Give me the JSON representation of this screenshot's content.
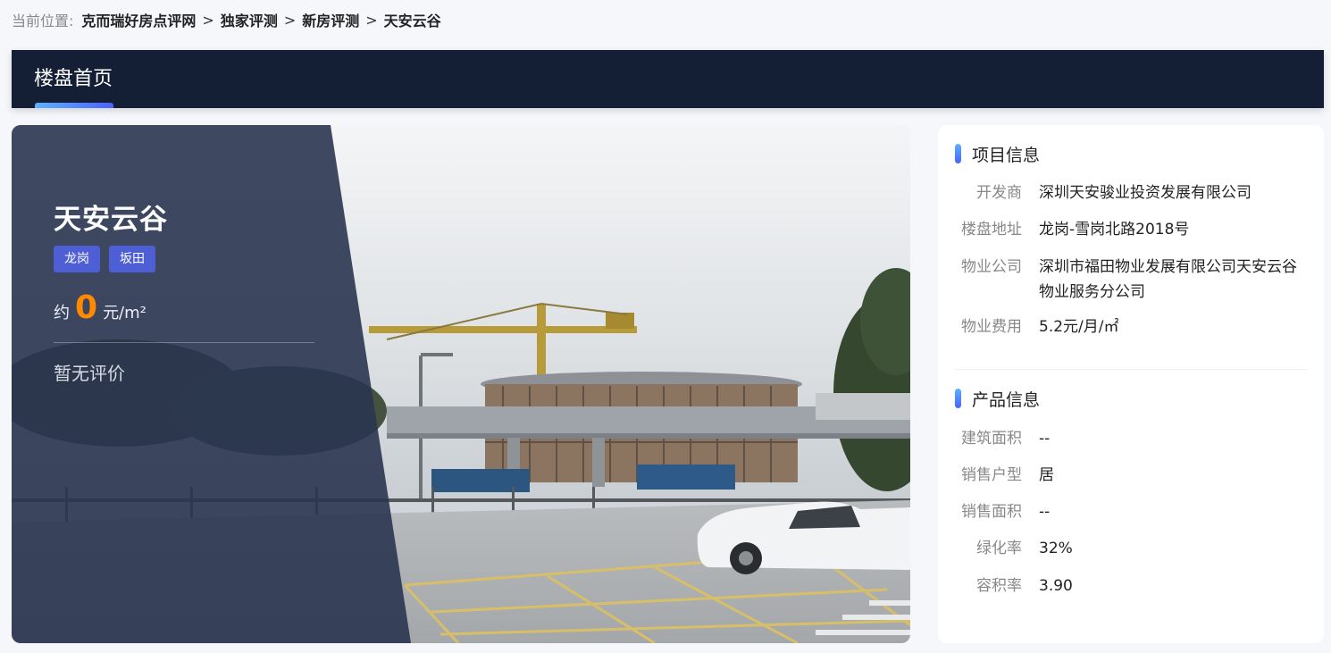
{
  "breadcrumb": {
    "lead": "当前位置:",
    "items": [
      "克而瑞好房点评网",
      "独家评测",
      "新房评测",
      "天安云谷"
    ],
    "separator": ">"
  },
  "nav": {
    "tabs": [
      {
        "label": "楼盘首页",
        "active": true
      }
    ]
  },
  "hero": {
    "title": "天安云谷",
    "tags": [
      "龙岗",
      "坂田"
    ],
    "price_prefix": "约",
    "price_value": "0",
    "price_unit": "元/m²",
    "review": "暂无评价"
  },
  "project_info": {
    "heading": "项目信息",
    "rows": [
      {
        "label": "开发商",
        "value": "深圳天安骏业投资发展有限公司"
      },
      {
        "label": "楼盘地址",
        "value": "龙岗-雪岗北路2018号"
      },
      {
        "label": "物业公司",
        "value": "深圳市福田物业发展有限公司天安云谷物业服务分公司"
      },
      {
        "label": "物业费用",
        "value": "5.2元/月/㎡"
      }
    ]
  },
  "product_info": {
    "heading": "产品信息",
    "rows": [
      {
        "label": "建筑面积",
        "value": "--"
      },
      {
        "label": "销售户型",
        "value": "居"
      },
      {
        "label": "销售面积",
        "value": "--"
      },
      {
        "label": "绿化率",
        "value": "32%"
      },
      {
        "label": "容积率",
        "value": "3.90"
      }
    ]
  },
  "colors": {
    "navbar_bg": "#141f36",
    "accent_orange": "#ff8a00",
    "tag_bg": "#4e5fd6",
    "accent_blue": "#4a62ff"
  }
}
